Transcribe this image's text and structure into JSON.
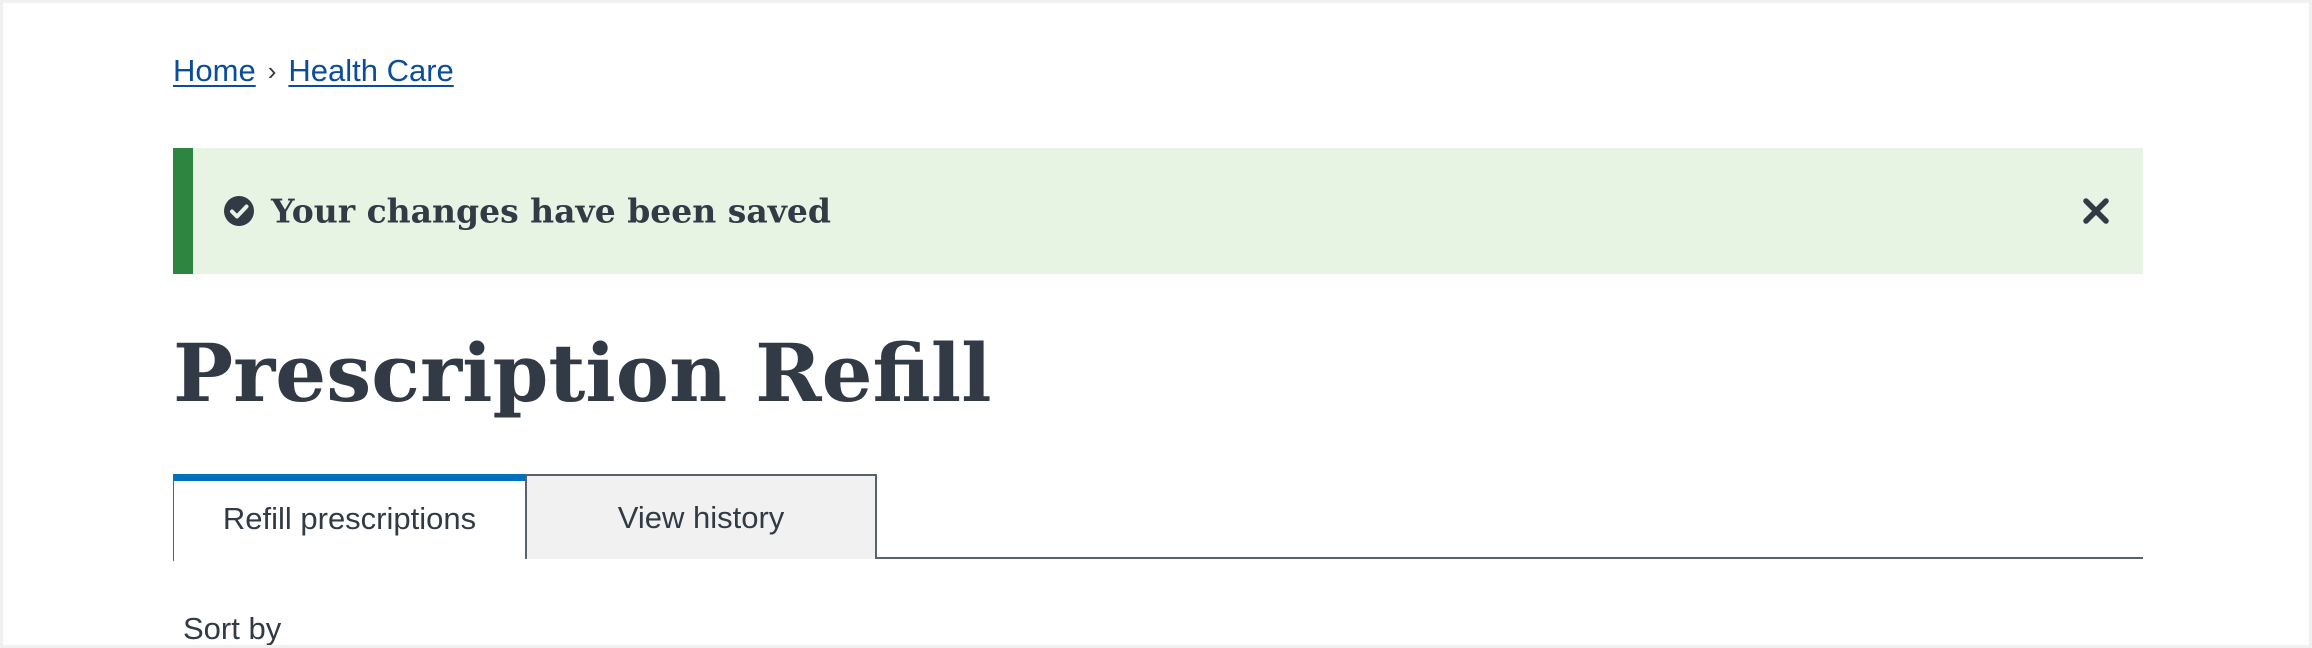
{
  "breadcrumb": {
    "items": [
      {
        "label": "Home"
      },
      {
        "label": "Health Care"
      }
    ],
    "separator": "›"
  },
  "alert": {
    "status": "success",
    "message": "Your changes have been saved",
    "icon": "check-circle-icon",
    "close_icon": "close-icon",
    "accent_color": "#2e8540",
    "background_color": "#e7f4e4"
  },
  "page": {
    "title": "Prescription Refill"
  },
  "tabs": [
    {
      "label": "Refill prescriptions",
      "active": true
    },
    {
      "label": "View history",
      "active": false
    }
  ],
  "tab_accent_color": "#0071bc",
  "link_color": "#0a4e9b",
  "sort": {
    "label": "Sort by"
  }
}
